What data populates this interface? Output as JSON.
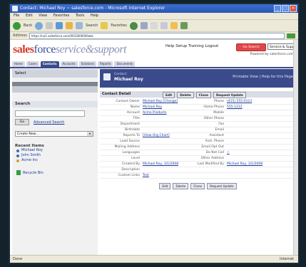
{
  "window": {
    "title": "Contact: Michael Roy ~ salesforce.com - Microsoft Internet Explorer"
  },
  "menu": [
    "File",
    "Edit",
    "View",
    "Favorites",
    "Tools",
    "Help"
  ],
  "toolbar": {
    "back": "Back",
    "search": "Search",
    "favorites": "Favorites"
  },
  "address": {
    "label": "Address",
    "url": "https://na1.salesforce.com/0033000000abc"
  },
  "header": {
    "logo_sales": "sales",
    "logo_force": "force",
    "logo_rest": "service&support",
    "toplinks": "Help  Setup  Training  Logout",
    "search_button": "Go Search",
    "select_value": "Service & Support",
    "subtext": "Powered by salesforce.com"
  },
  "tabs": [
    "Home",
    "Cases",
    "Contacts",
    "Accounts",
    "Solutions",
    "Reports",
    "Documents"
  ],
  "sidebar": {
    "new_label": "Select",
    "search_title": "Search",
    "go_label": "Go",
    "advanced_link": "Advanced Search",
    "create_new": "Create New...",
    "recent_title": "Recent Items",
    "recent": [
      "Michael Roy",
      "John Smith",
      "Acme Inc"
    ],
    "recycle": "Recycle Bin"
  },
  "main": {
    "label": "Contact",
    "name": "Michael Roy",
    "help_link": "Printable View | Help for this Page",
    "detail_title": "Contact Detail",
    "buttons": [
      "Edit",
      "Delete",
      "Clone",
      "Request Update"
    ],
    "rows": [
      [
        "Contact Owner",
        "Michael Roy [Change]",
        "Phone",
        "(415) 555-0123"
      ],
      [
        "Name",
        "Michael Roy",
        "Home Phone",
        "555-1212"
      ],
      [
        "Account",
        "Acme Products",
        "Mobile",
        ""
      ],
      [
        "Title",
        "",
        "Other Phone",
        ""
      ],
      [
        "Department",
        "",
        "Fax",
        ""
      ],
      [
        "Birthdate",
        "",
        "Email",
        ""
      ],
      [
        "Reports To",
        "[View Org Chart]",
        "Assistant",
        ""
      ],
      [
        "Lead Source",
        "",
        "Asst. Phone",
        ""
      ],
      [
        "Mailing Address",
        "",
        "Email Opt Out",
        ""
      ],
      [
        "Languages",
        "",
        "Do Not Call",
        "✓"
      ],
      [
        "Level",
        "",
        "Other Address",
        ""
      ],
      [
        "Created By",
        "Michael Roy, 3/1/2008",
        "Last Modified By",
        "Michael Roy, 3/1/2008"
      ],
      [
        "Description",
        "",
        "",
        ""
      ],
      [
        "Custom Links",
        "Test",
        "",
        ""
      ]
    ]
  },
  "status": {
    "left": "Done",
    "zone": "Internet"
  }
}
